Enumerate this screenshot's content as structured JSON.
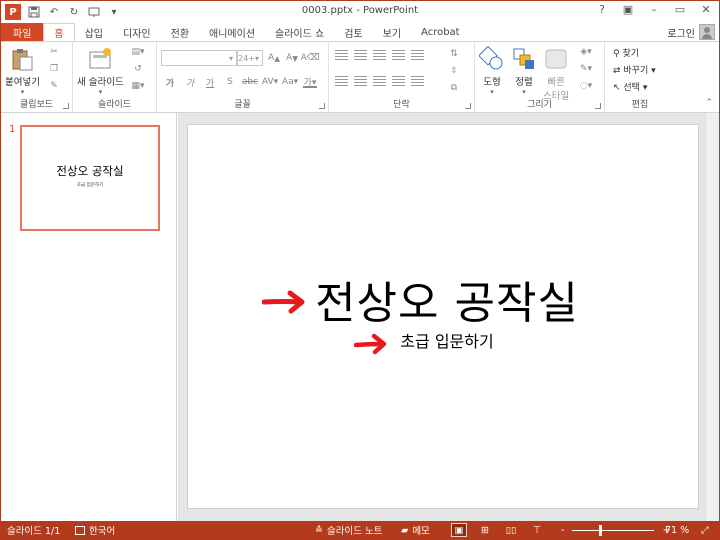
{
  "window": {
    "title": "0003.pptx - PowerPoint",
    "help": "?",
    "minimize": "–",
    "restore": "▭",
    "close": "✕"
  },
  "tabs": {
    "file": "파일",
    "home": "홈",
    "insert": "삽입",
    "design": "디자인",
    "transitions": "전환",
    "animations": "애니메이션",
    "slideshow": "슬라이드 쇼",
    "review": "검토",
    "view": "보기",
    "acrobat": "Acrobat",
    "login": "로그인"
  },
  "ribbon": {
    "clipboard": {
      "label": "클립보드",
      "paste": "붙여넣기"
    },
    "slides": {
      "label": "슬라이드",
      "new_slide": "새 슬라이드"
    },
    "font": {
      "label": "글꼴",
      "size": "24+"
    },
    "paragraph": {
      "label": "단락"
    },
    "drawing": {
      "label": "그리기",
      "shapes": "도형",
      "arrange": "정렬",
      "quick_styles_1": "빠른",
      "quick_styles_2": "스타일"
    },
    "editing": {
      "label": "편집",
      "find": "찾기",
      "replace": "바꾸기",
      "select": "선택"
    }
  },
  "thumbnails": [
    {
      "number": "1",
      "title": "전상오 공작실",
      "subtitle": "초급 입문하기"
    }
  ],
  "slide": {
    "title": "전상오 공작실",
    "subtitle": "초급 입문하기",
    "arrow_color": "#e8181d"
  },
  "status": {
    "slide_count": "슬라이드 1/1",
    "language": "한국어",
    "notes": "슬라이드 노트",
    "comments": "메모",
    "zoom_minus": "-",
    "zoom_plus": "+",
    "zoom_level": 71,
    "zoom_text": "71 %"
  },
  "colors": {
    "accent": "#d24726",
    "status_bar": "#b33a1c"
  }
}
